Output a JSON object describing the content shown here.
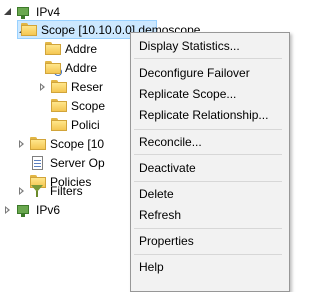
{
  "tree": {
    "ipv4": {
      "label": "IPv4"
    },
    "scope_selected": {
      "label": "Scope [10.10.0.0] demoscope"
    },
    "address_pool": {
      "label": "Addre"
    },
    "address_leases": {
      "label": "Addre"
    },
    "reservations": {
      "label": "Reser"
    },
    "scope_options": {
      "label": "Scope"
    },
    "policies_child": {
      "label": "Polici"
    },
    "scope_other": {
      "label": "Scope [10"
    },
    "server_options": {
      "label": "Server Op"
    },
    "policies": {
      "label": "Policies"
    },
    "filters": {
      "label": "Filters"
    },
    "ipv6": {
      "label": "IPv6"
    }
  },
  "context_menu": {
    "display_statistics": "Display Statistics...",
    "deconfigure_failover": "Deconfigure Failover",
    "replicate_scope": "Replicate Scope...",
    "replicate_relationship": "Replicate Relationship...",
    "reconcile": "Reconcile...",
    "deactivate": "Deactivate",
    "delete": "Delete",
    "refresh": "Refresh",
    "properties": "Properties",
    "help": "Help"
  },
  "colors": {
    "selection_bg": "#cce8ff",
    "menu_bg": "#f2f2f2"
  }
}
